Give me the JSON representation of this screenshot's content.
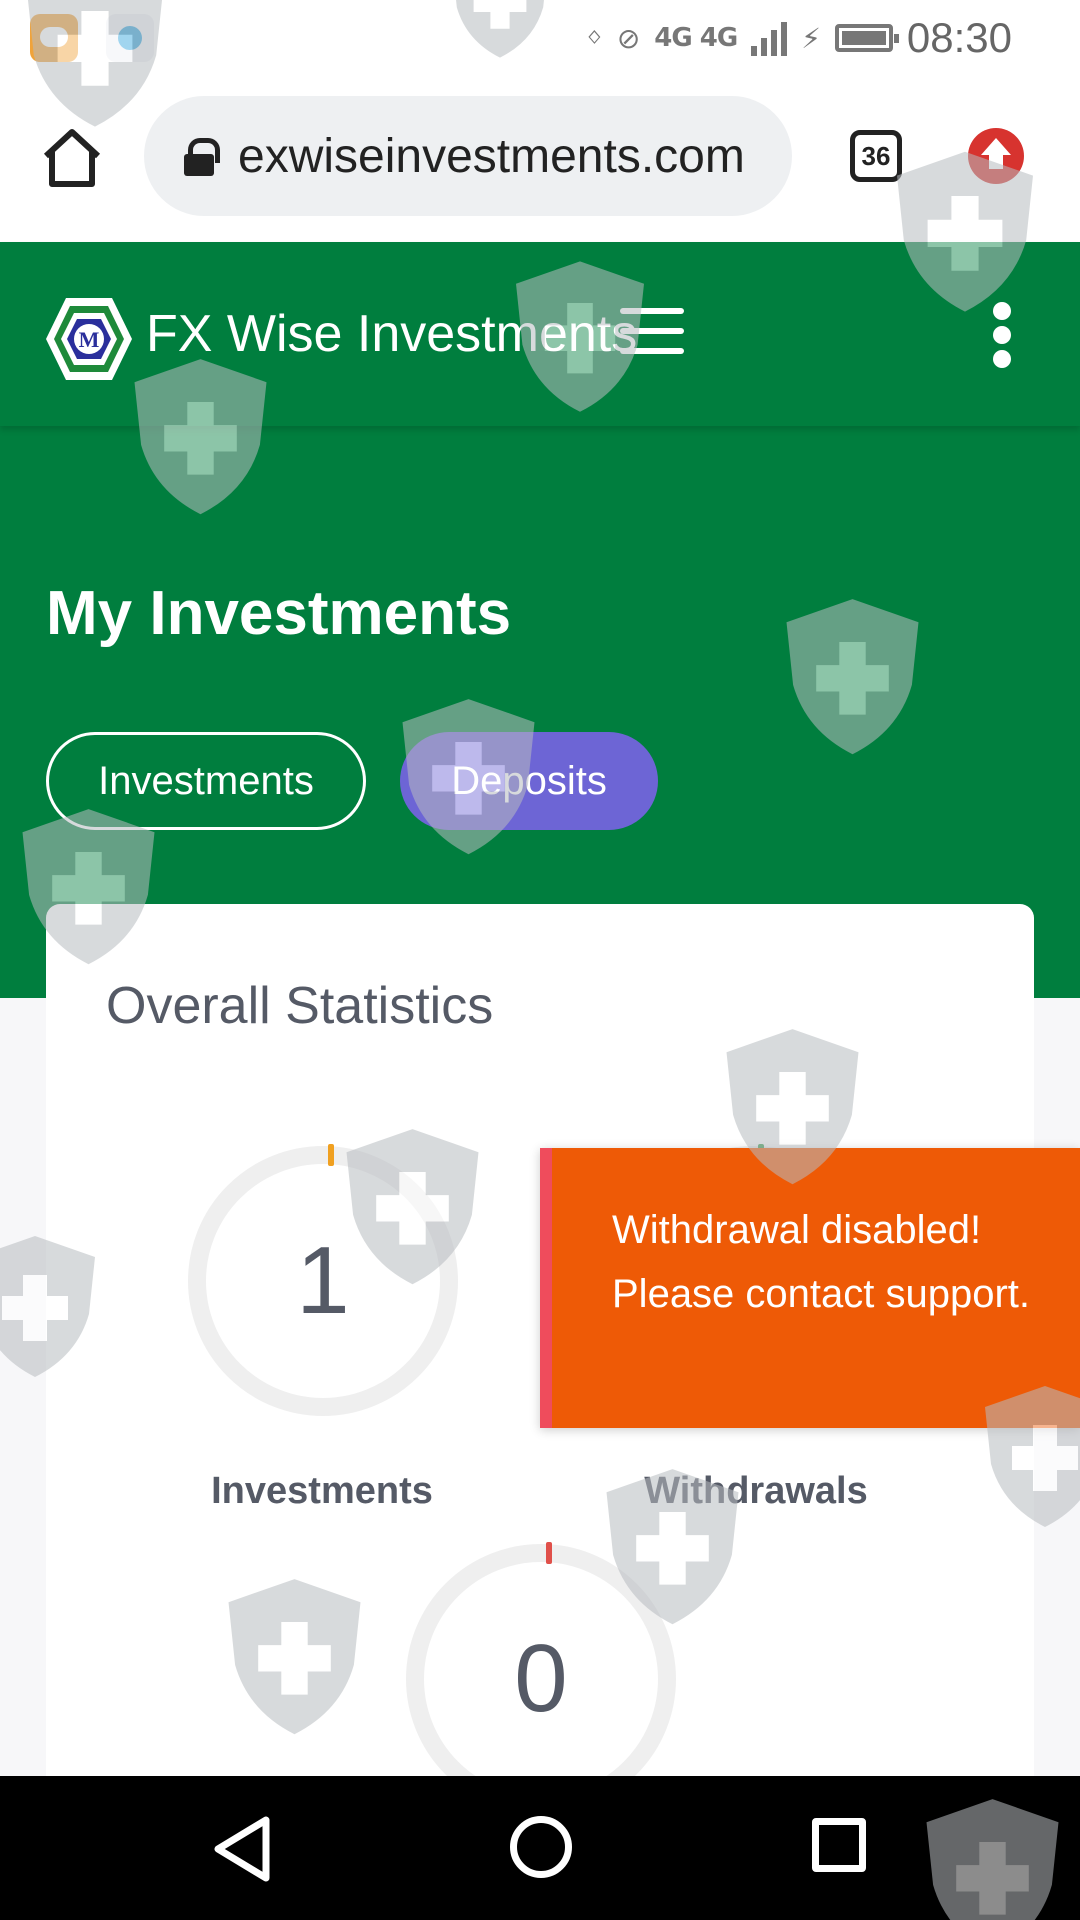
{
  "status_bar": {
    "time": "08:30",
    "network_label": "4G 4G"
  },
  "browser": {
    "url": "exwiseinvestments.com",
    "tab_count": "36"
  },
  "site": {
    "brand": "FX Wise Investments",
    "logo_letter": "M"
  },
  "hero": {
    "title": "My Investments",
    "tabs": [
      {
        "label": "Investments",
        "active": false
      },
      {
        "label": "Deposits",
        "active": true
      }
    ]
  },
  "stats": {
    "title": "Overall Statistics",
    "items": [
      {
        "label": "Investments",
        "value": "1",
        "accent": "#f0a020"
      },
      {
        "label": "Withdrawals",
        "value": "",
        "accent": "#3aa050"
      },
      {
        "label": "",
        "value": "0",
        "accent": "#e0504a"
      }
    ]
  },
  "toast": {
    "message": "Withdrawal disabled! Please contact support."
  },
  "colors": {
    "brand_green": "#007e3e",
    "deposits_pill": "#6d65d5",
    "toast_bg": "#ee5a06",
    "toast_border": "#ef4c5c"
  },
  "icons": [
    "bluetooth-icon",
    "mute-icon",
    "signal-icon",
    "charging-icon",
    "battery-icon",
    "home-icon",
    "lock-icon",
    "tabs-icon",
    "update-icon",
    "menu-icon",
    "more-icon",
    "back-icon",
    "recents-icon",
    "shield-watermark-icon"
  ]
}
